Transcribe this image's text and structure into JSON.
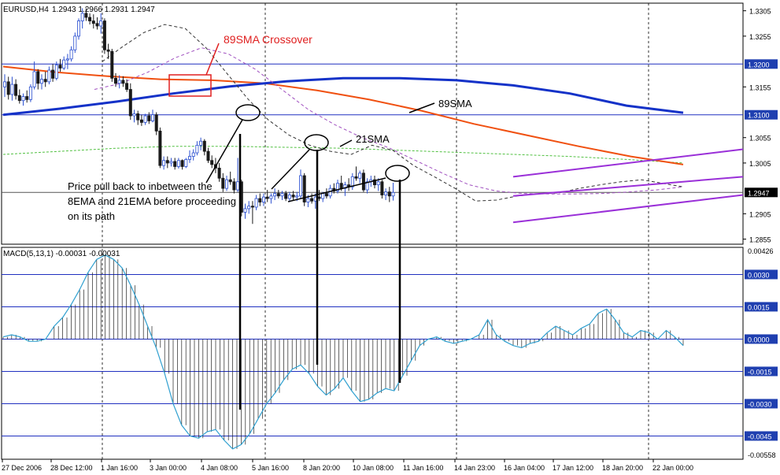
{
  "window": {
    "symbol_label": "EURUSD,H4",
    "ohlc_label": "1.2943 1.2966 1.2931 1.2947",
    "indicator_label": "MACD(5,13,1) -0.00031 -0.00031"
  },
  "annotations": {
    "crossover": "89SMA Crossover",
    "sma89": "89SMA",
    "sma21": "21SMA",
    "pullback_line1": "Price pull back to inbetween the",
    "pullback_line2": "8EMA and 21EMA before proceeding",
    "pullback_line3": "on its path"
  },
  "colors": {
    "background": "#ffffff",
    "bull_candle": "#2a4fd0",
    "bear_candle": "#1a1a1a",
    "sma89": "#1432c8",
    "orange_ma": "#f05010",
    "ema8": "#333333",
    "sma21": "#a050c0",
    "green_ma": "#50c040",
    "channel": "#9a30d8",
    "hline": "#2030c0",
    "macd_signal": "#30a0d0",
    "macd_bars": "#222222",
    "crossover_text": "#e02020",
    "price_tag_bg": "#1f3fb0"
  },
  "chart_data": [
    {
      "type": "candlestick",
      "symbol": "EURUSD",
      "timeframe": "H4",
      "y_ticks": [
        "1.3305",
        "1.3255",
        "1.3200",
        "1.3155",
        "1.3100",
        "1.3055",
        "1.3005",
        "1.2947",
        "1.2905",
        "1.2855"
      ],
      "ylim": [
        1.2845,
        1.332
      ],
      "x_ticks": [
        "27 Dec 2006",
        "28 Dec 12:00",
        "1 Jan 16:00",
        "3 Jan 00:00",
        "4 Jan 08:00",
        "5 Jan 16:00",
        "8 Jan 20:00",
        "10 Jan 08:00",
        "11 Jan 16:00",
        "14 Jan 23:00",
        "16 Jan 04:00",
        "17 Jan 12:00",
        "18 Jan 20:00",
        "22 Jan 00:00"
      ],
      "horizontal_levels": [
        {
          "label": "1.3200",
          "value": 1.32
        },
        {
          "label": "1.3100",
          "value": 1.31
        },
        {
          "label": "1.2947",
          "value": 1.2947
        }
      ],
      "candles": [
        [
          1.3155,
          1.318,
          1.3135,
          1.3165
        ],
        [
          1.3165,
          1.3175,
          1.313,
          1.314
        ],
        [
          1.314,
          1.3175,
          1.3128,
          1.316
        ],
        [
          1.316,
          1.317,
          1.313,
          1.3138
        ],
        [
          1.3138,
          1.315,
          1.3122,
          1.3128
        ],
        [
          1.3128,
          1.3142,
          1.3118,
          1.3136
        ],
        [
          1.3136,
          1.3148,
          1.3124,
          1.313
        ],
        [
          1.313,
          1.316,
          1.3125,
          1.3155
        ],
        [
          1.3155,
          1.3205,
          1.315,
          1.3185
        ],
        [
          1.3185,
          1.319,
          1.315,
          1.3162
        ],
        [
          1.3162,
          1.318,
          1.315,
          1.317
        ],
        [
          1.317,
          1.3185,
          1.3155,
          1.3165
        ],
        [
          1.3165,
          1.3195,
          1.316,
          1.3188
        ],
        [
          1.3188,
          1.32,
          1.3165,
          1.3172
        ],
        [
          1.3172,
          1.3205,
          1.3168,
          1.3198
        ],
        [
          1.3198,
          1.321,
          1.3185,
          1.3192
        ],
        [
          1.3192,
          1.3215,
          1.3188,
          1.3208
        ],
        [
          1.3208,
          1.322,
          1.319,
          1.321
        ],
        [
          1.321,
          1.3235,
          1.3205,
          1.3228
        ],
        [
          1.3228,
          1.3262,
          1.3222,
          1.3255
        ],
        [
          1.3255,
          1.329,
          1.3248,
          1.3285
        ],
        [
          1.3285,
          1.331,
          1.327,
          1.33
        ],
        [
          1.33,
          1.331,
          1.3285,
          1.3292
        ],
        [
          1.3292,
          1.33,
          1.3278,
          1.3285
        ],
        [
          1.3285,
          1.3298,
          1.327,
          1.328
        ],
        [
          1.328,
          1.3292,
          1.3268,
          1.3275
        ],
        [
          1.3275,
          1.33,
          1.326,
          1.3285
        ],
        [
          1.3285,
          1.329,
          1.322,
          1.3228
        ],
        [
          1.3228,
          1.324,
          1.321,
          1.3225
        ],
        [
          1.3225,
          1.323,
          1.3165,
          1.3172
        ],
        [
          1.3172,
          1.3182,
          1.3155,
          1.3162
        ],
        [
          1.3162,
          1.3178,
          1.3152,
          1.3168
        ],
        [
          1.3168,
          1.3176,
          1.3155,
          1.3162
        ],
        [
          1.3162,
          1.317,
          1.3145,
          1.315
        ],
        [
          1.315,
          1.3162,
          1.309,
          1.3098
        ],
        [
          1.3098,
          1.311,
          1.3085,
          1.3102
        ],
        [
          1.3102,
          1.3108,
          1.308,
          1.309
        ],
        [
          1.309,
          1.31,
          1.3078,
          1.3085
        ],
        [
          1.3085,
          1.3102,
          1.308,
          1.3098
        ],
        [
          1.3098,
          1.3105,
          1.3082,
          1.3088
        ],
        [
          1.3088,
          1.311,
          1.3085,
          1.31
        ],
        [
          1.31,
          1.3105,
          1.306,
          1.3068
        ],
        [
          1.3068,
          1.3075,
          1.2995,
          1.3
        ],
        [
          1.3,
          1.3018,
          1.2992,
          1.301
        ],
        [
          1.301,
          1.3018,
          1.2995,
          1.3005
        ],
        [
          1.3005,
          1.3015,
          1.2998,
          1.3008
        ],
        [
          1.3008,
          1.3015,
          1.2992,
          1.2998
        ],
        [
          1.2998,
          1.3015,
          1.2994,
          1.301
        ],
        [
          1.301,
          1.3012,
          1.2992,
          1.2998
        ],
        [
          1.2998,
          1.3015,
          1.2995,
          1.3012
        ],
        [
          1.3012,
          1.303,
          1.3005,
          1.3018
        ],
        [
          1.3018,
          1.3032,
          1.301,
          1.3025
        ],
        [
          1.3025,
          1.3048,
          1.302,
          1.304
        ],
        [
          1.304,
          1.3055,
          1.303,
          1.3048
        ],
        [
          1.3048,
          1.3052,
          1.302,
          1.3028
        ],
        [
          1.3028,
          1.3035,
          1.3005,
          1.301
        ],
        [
          1.301,
          1.302,
          1.2995,
          1.3002
        ],
        [
          1.3002,
          1.3015,
          1.2985,
          1.2995
        ],
        [
          1.2995,
          1.3005,
          1.2968,
          1.2975
        ],
        [
          1.2975,
          1.2985,
          1.2948,
          1.2955
        ],
        [
          1.2955,
          1.298,
          1.295,
          1.2972
        ],
        [
          1.2972,
          1.2988,
          1.2962,
          1.2968
        ],
        [
          1.2968,
          1.2975,
          1.2945,
          1.2952
        ],
        [
          1.2952,
          1.3015,
          1.2948,
          1.2968
        ],
        [
          1.2968,
          1.2972,
          1.29,
          1.2908
        ],
        [
          1.2908,
          1.2925,
          1.2895,
          1.2915
        ],
        [
          1.2915,
          1.293,
          1.2905,
          1.292
        ],
        [
          1.292,
          1.293,
          1.2885,
          1.2918
        ],
        [
          1.2918,
          1.2942,
          1.2912,
          1.2935
        ],
        [
          1.2935,
          1.2945,
          1.292,
          1.2928
        ],
        [
          1.2928,
          1.2945,
          1.292,
          1.2938
        ],
        [
          1.2938,
          1.2952,
          1.2928,
          1.2935
        ],
        [
          1.2935,
          1.2945,
          1.2925,
          1.294
        ],
        [
          1.294,
          1.2955,
          1.2932,
          1.2945
        ],
        [
          1.2945,
          1.2952,
          1.2935,
          1.294
        ],
        [
          1.294,
          1.295,
          1.2932,
          1.2945
        ],
        [
          1.2945,
          1.295,
          1.293,
          1.2935
        ],
        [
          1.2935,
          1.2948,
          1.2928,
          1.2942
        ],
        [
          1.2942,
          1.295,
          1.2932,
          1.2938
        ],
        [
          1.2938,
          1.2948,
          1.293,
          1.294
        ],
        [
          1.294,
          1.2992,
          1.2935,
          1.298
        ],
        [
          1.298,
          1.2985,
          1.292,
          1.2928
        ],
        [
          1.2928,
          1.2942,
          1.2918,
          1.2935
        ],
        [
          1.2935,
          1.2945,
          1.2925,
          1.293
        ],
        [
          1.293,
          1.2945,
          1.2915,
          1.2938
        ],
        [
          1.2938,
          1.2952,
          1.293,
          1.2935
        ],
        [
          1.2935,
          1.2948,
          1.2928,
          1.2945
        ],
        [
          1.2945,
          1.2955,
          1.2935,
          1.294
        ],
        [
          1.294,
          1.2962,
          1.2935,
          1.2955
        ],
        [
          1.2955,
          1.2965,
          1.2945,
          1.295
        ],
        [
          1.295,
          1.2972,
          1.2945,
          1.2965
        ],
        [
          1.2965,
          1.298,
          1.295,
          1.2955
        ],
        [
          1.2955,
          1.2968,
          1.294,
          1.2962
        ],
        [
          1.2962,
          1.2975,
          1.295,
          1.2958
        ],
        [
          1.2958,
          1.2985,
          1.2952,
          1.2978
        ],
        [
          1.2978,
          1.2998,
          1.297,
          1.2975
        ],
        [
          1.2975,
          1.299,
          1.2965,
          1.2985
        ],
        [
          1.2985,
          1.2992,
          1.2948,
          1.2952
        ],
        [
          1.2952,
          1.2975,
          1.2945,
          1.2968
        ],
        [
          1.2968,
          1.298,
          1.2958,
          1.2972
        ],
        [
          1.2972,
          1.298,
          1.2955,
          1.2962
        ],
        [
          1.2962,
          1.2975,
          1.295,
          1.2968
        ],
        [
          1.2968,
          1.2972,
          1.2935,
          1.2942
        ],
        [
          1.2942,
          1.2955,
          1.2932,
          1.2948
        ],
        [
          1.2948,
          1.2958,
          1.2928,
          1.294
        ],
        [
          1.294,
          1.2966,
          1.2931,
          1.2947
        ]
      ],
      "channel": {
        "upper": [
          [
            1.2978,
            1.3032
          ]
        ],
        "middle": [
          [
            1.294,
            1.2978
          ]
        ],
        "lower": [
          [
            1.2888,
            1.2942
          ]
        ]
      },
      "sma89": [
        1.31,
        1.3112,
        1.3126,
        1.3142,
        1.3156,
        1.3166,
        1.3172,
        1.3172,
        1.3168,
        1.3158,
        1.3142,
        1.3118,
        1.3104
      ],
      "orange_ma": [
        1.3195,
        1.3184,
        1.3176,
        1.317,
        1.3168,
        1.3162,
        1.3148,
        1.313,
        1.3108,
        1.3082,
        1.306,
        1.3038,
        1.3018,
        1.3002
      ],
      "green_ma": [
        1.3022,
        1.3028,
        1.3034,
        1.3038,
        1.3038,
        1.3036,
        1.3034,
        1.303,
        1.3026,
        1.3022,
        1.3018,
        1.3012,
        1.3005
      ],
      "sma21": [
        1.315,
        1.3162,
        1.3184,
        1.3212,
        1.3232,
        1.322,
        1.319,
        1.315,
        1.311,
        1.308,
        1.3055,
        1.3035,
        1.301,
        1.2985,
        1.2962,
        1.295,
        1.2945,
        1.2944,
        1.2944,
        1.2945,
        1.2948,
        1.2952,
        1.2958
      ],
      "ema8": [
        1.3205,
        1.3235,
        1.3262,
        1.3278,
        1.327,
        1.3232,
        1.3182,
        1.3132,
        1.309,
        1.306,
        1.304,
        1.3028,
        1.3022,
        1.304,
        1.303,
        1.3,
        1.2978,
        1.2955,
        1.293,
        1.2932,
        1.294,
        1.2944,
        1.2946,
        1.2955,
        1.2962,
        1.2968,
        1.2972,
        1.2965,
        1.2958
      ]
    },
    {
      "type": "bar",
      "title": "MACD(5,13,1)",
      "value": -0.00031,
      "y_ticks": [
        "0.00426",
        "0.0030",
        "0.0015",
        "0.0000",
        "-0.0015",
        "-0.0030",
        "-0.0045",
        "-0.00558"
      ],
      "ylim": [
        -0.00558,
        0.00426
      ],
      "values": [
        0.0001,
        0.0002,
        0.0001,
        -0.0001,
        -0.0001,
        0.0,
        0.0006,
        0.001,
        0.0016,
        0.0023,
        0.0031,
        0.0037,
        0.0039,
        0.0037,
        0.0033,
        0.0025,
        0.0016,
        0.0006,
        -0.0004,
        -0.0016,
        -0.003,
        -0.004,
        -0.0045,
        -0.0046,
        -0.0043,
        -0.0042,
        -0.0047,
        -0.0051,
        -0.0049,
        -0.0044,
        -0.0037,
        -0.003,
        -0.0025,
        -0.0019,
        -0.0014,
        -0.0012,
        -0.0016,
        -0.0022,
        -0.0026,
        -0.0023,
        -0.0018,
        -0.0024,
        -0.0029,
        -0.0028,
        -0.0025,
        -0.0023,
        -0.0024,
        -0.0017,
        -0.001,
        -0.0003,
        0.0,
        0.0001,
        -0.0001,
        -0.0002,
        -0.0001,
        0.0,
        0.0002,
        0.0009,
        0.0002,
        -0.0001,
        -0.0003,
        -0.0004,
        -0.0002,
        -0.0001,
        0.0003,
        0.0006,
        0.0004,
        0.0002,
        0.0005,
        0.0007,
        0.0012,
        0.0014,
        0.0009,
        0.0003,
        0.0001,
        0.0004,
        0.0003,
        0.0,
        0.0004,
        0.0001,
        -0.0003
      ]
    }
  ]
}
